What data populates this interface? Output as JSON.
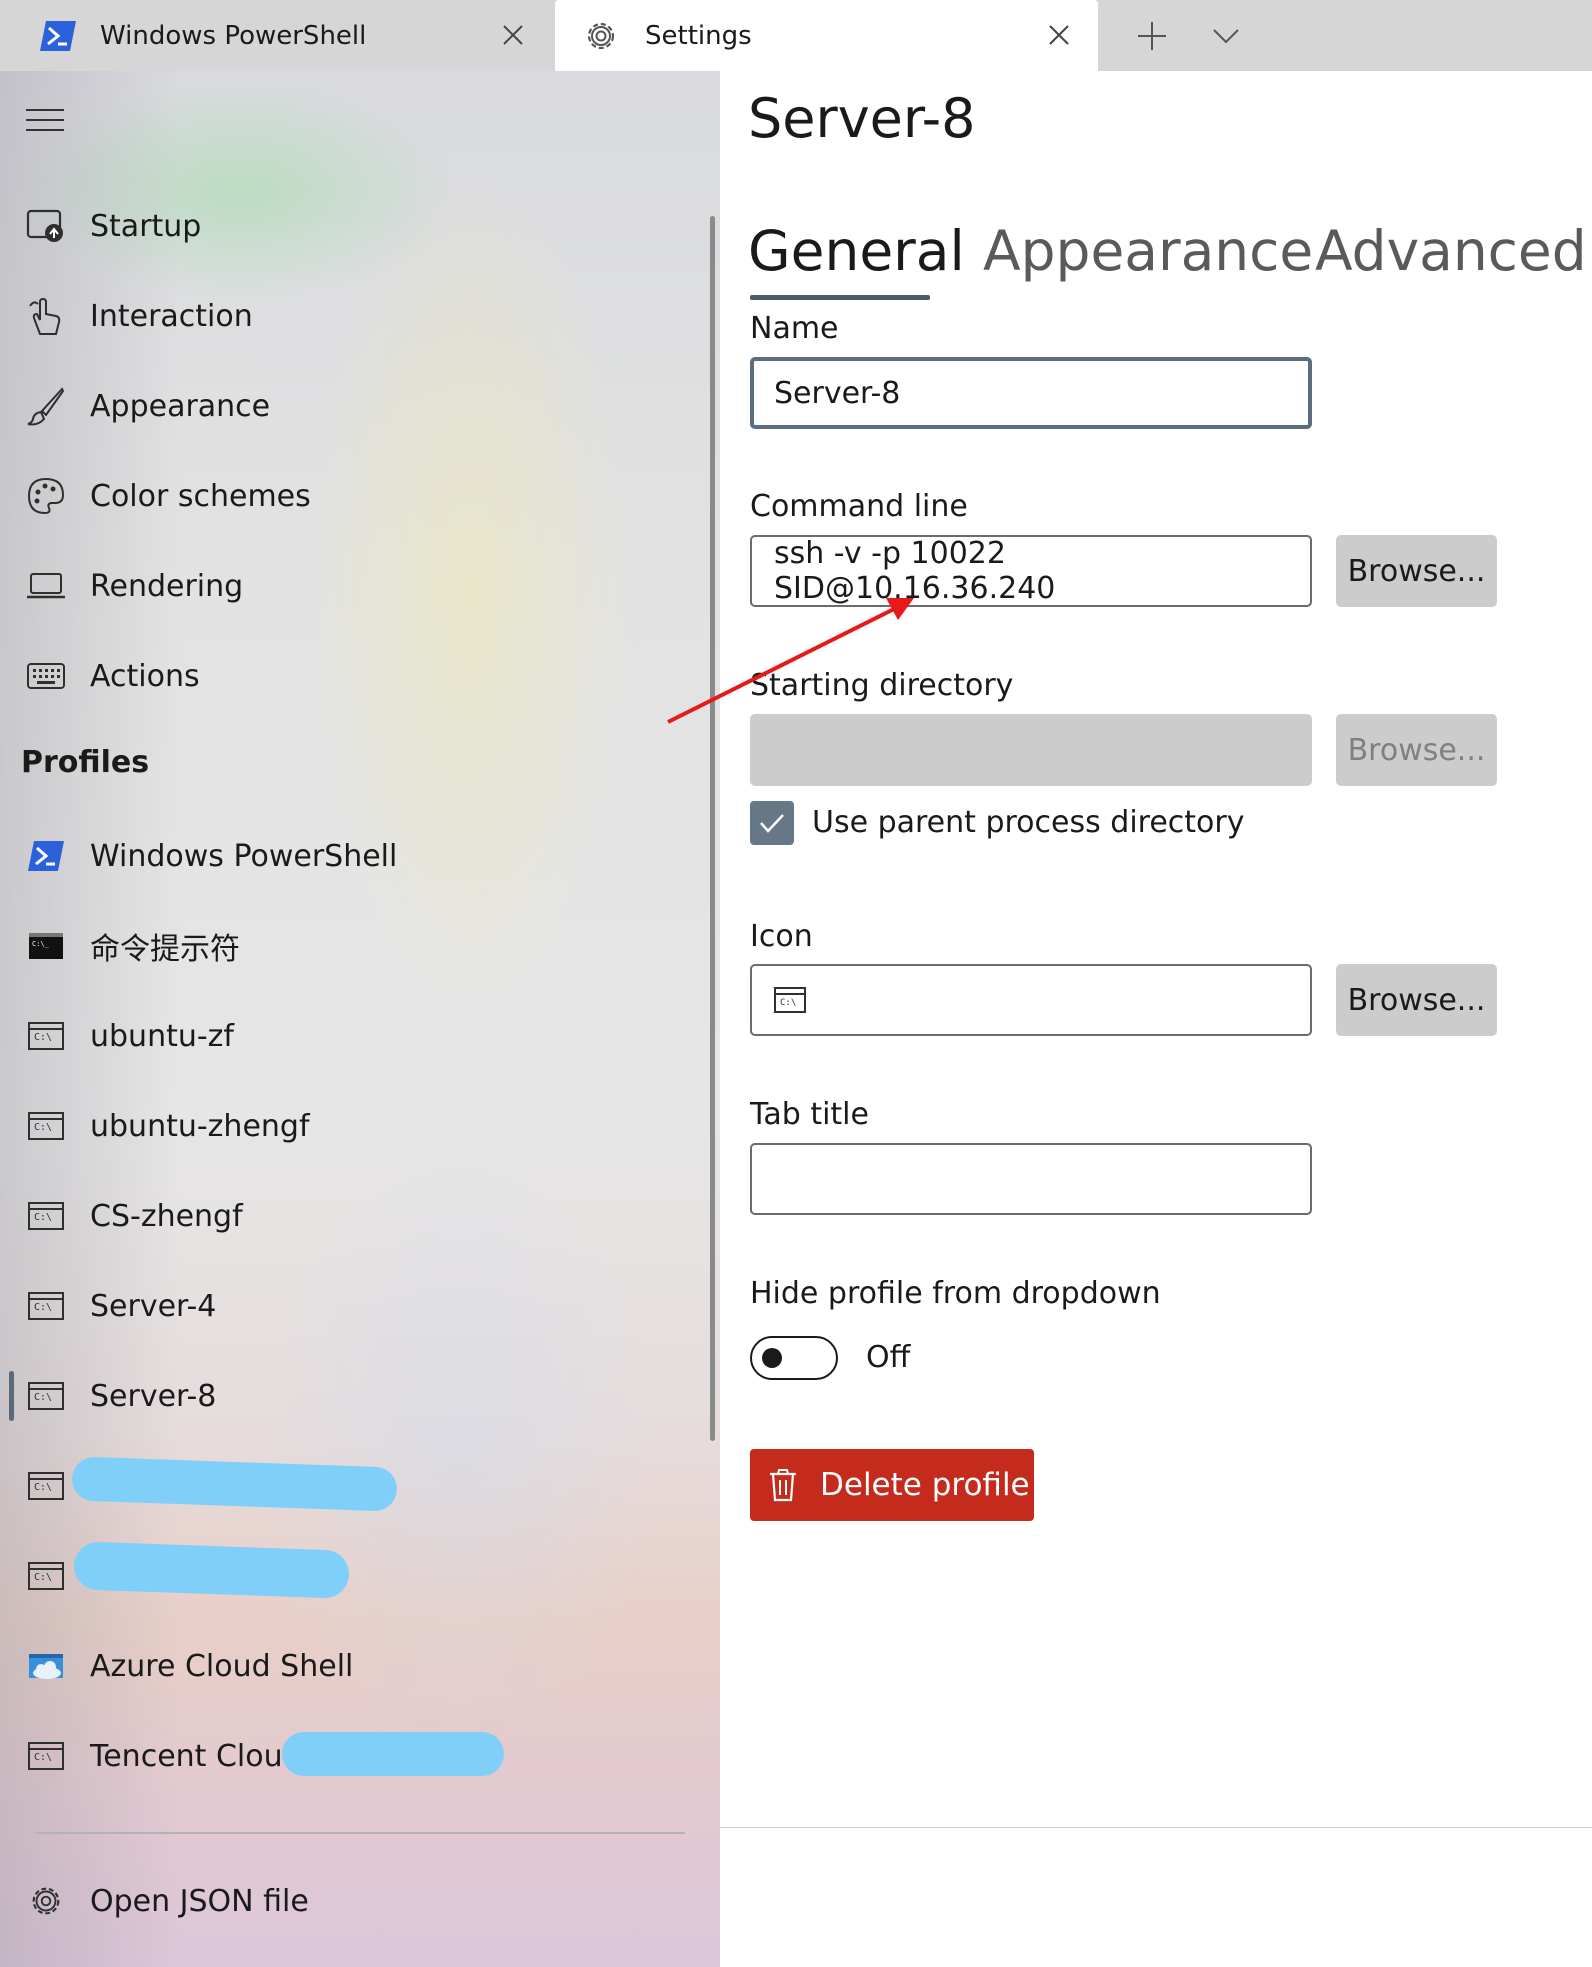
{
  "tabs": [
    {
      "label": "Windows PowerShell",
      "icon": "powershell-icon"
    },
    {
      "label": "Settings",
      "icon": "gear-icon"
    }
  ],
  "sidebar": {
    "items": [
      {
        "label": "Startup",
        "icon": "startup-icon"
      },
      {
        "label": "Interaction",
        "icon": "interaction-icon"
      },
      {
        "label": "Appearance",
        "icon": "brush-icon"
      },
      {
        "label": "Color schemes",
        "icon": "palette-icon"
      },
      {
        "label": "Rendering",
        "icon": "laptop-icon"
      },
      {
        "label": "Actions",
        "icon": "keyboard-icon"
      }
    ],
    "profiles_header": "Profiles",
    "profiles": [
      {
        "label": "Windows PowerShell",
        "icon": "powershell-icon"
      },
      {
        "label": "命令提示符",
        "icon": "cmd-black-icon"
      },
      {
        "label": "ubuntu-zf",
        "icon": "terminal-icon"
      },
      {
        "label": "ubuntu-zhengf",
        "icon": "terminal-icon"
      },
      {
        "label": "CS-zhengf",
        "icon": "terminal-icon"
      },
      {
        "label": "Server-4",
        "icon": "terminal-icon"
      },
      {
        "label": "Server-8",
        "icon": "terminal-icon",
        "selected": true
      },
      {
        "label": "",
        "icon": "terminal-icon",
        "redacted": true
      },
      {
        "label": "",
        "icon": "terminal-icon",
        "redacted": true
      },
      {
        "label": "Azure Cloud Shell",
        "icon": "azure-icon"
      },
      {
        "label": "Tencent Clouc",
        "icon": "terminal-icon",
        "partially_redacted": true
      }
    ],
    "open_json": "Open JSON file"
  },
  "main": {
    "title": "Server-8",
    "tabs": [
      "General",
      "Appearance",
      "Advanced"
    ],
    "active_tab": "General",
    "name": {
      "label": "Name",
      "value": "Server-8"
    },
    "command_line": {
      "label": "Command line",
      "value": "ssh -v -p 10022 SID@10.16.36.240",
      "browse": "Browse..."
    },
    "starting_directory": {
      "label": "Starting directory",
      "value": "",
      "browse": "Browse...",
      "disabled": true
    },
    "use_parent": {
      "label": "Use parent process directory",
      "checked": true
    },
    "icon": {
      "label": "Icon",
      "value_icon": "terminal-icon",
      "browse": "Browse..."
    },
    "tab_title": {
      "label": "Tab title",
      "value": ""
    },
    "hide_profile": {
      "label": "Hide profile from dropdown",
      "state": "Off"
    },
    "delete": {
      "label": "Delete profile"
    }
  },
  "colors": {
    "accent": "#5a6e80",
    "delete": "#c42b1c",
    "redaction": "#7fcff9",
    "annotation_arrow": "#e8191b"
  }
}
